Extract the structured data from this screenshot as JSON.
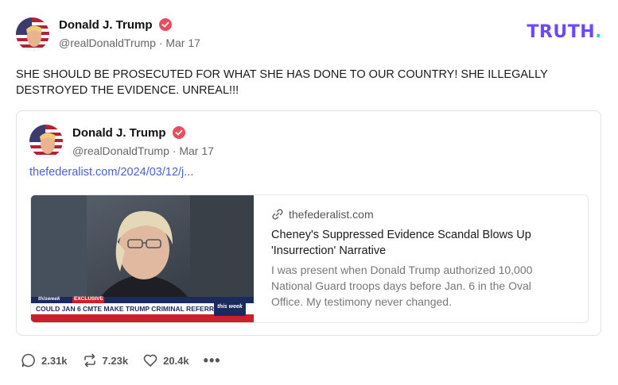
{
  "post": {
    "author_name": "Donald J. Trump",
    "author_handle": "@realDonaldTrump",
    "date": "Mar 17",
    "text_line1": "SHE SHOULD BE PROSECUTED FOR WHAT SHE HAS DONE TO OUR COUNTRY! SHE ILLEGALLY",
    "text_line2": "DESTROYED THE EVIDENCE. UNREAL!!!"
  },
  "brand": {
    "logo_text": "TRUTH",
    "logo_dot": ".",
    "logo_color": "#6b49ff",
    "dot_color": "#35d1c7"
  },
  "quote": {
    "author_name": "Donald J. Trump",
    "author_handle": "@realDonaldTrump",
    "date": "Mar 17",
    "link_text": "thefederalist.com/2024/03/12/j...",
    "card": {
      "domain": "thefederalist.com",
      "title": "Cheney's Suppressed Evidence Scandal Blows Up 'Insurrection' Narrative",
      "description": "I was present when Donald Trump authorized 10,000 National Guard troops days before Jan. 6 in the Oval Office. My testimony never changed.",
      "thumbnail": {
        "network_label": "thisweek",
        "exclusive_label": "EXCLUSIVE",
        "headline": "COULD JAN 6 CMTE MAKE TRUMP CRIMINAL REFERRAL?",
        "logo": "this week"
      }
    }
  },
  "stats": {
    "replies": "2.31k",
    "retruths": "7.23k",
    "likes": "20.4k",
    "more": "•••"
  },
  "colors": {
    "verified": "#ea4c5e",
    "link": "#4a63c8"
  }
}
